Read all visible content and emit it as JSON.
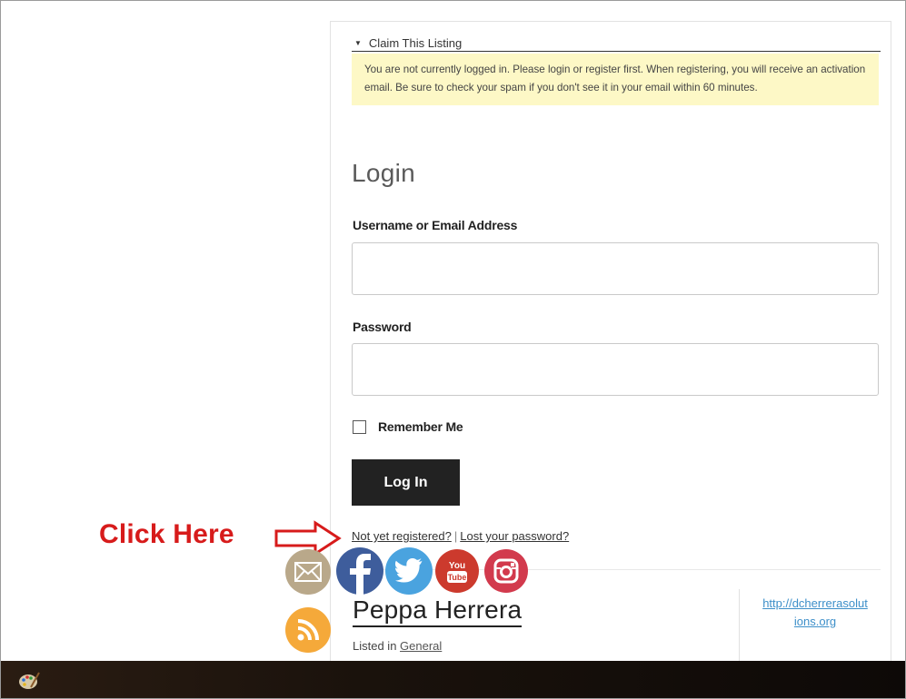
{
  "claim": {
    "header": "Claim This Listing",
    "notice": "You are not currently logged in. Please login or register first. When registering, you will receive an activation email. Be sure to check your spam if you don't see it in your email within 60 minutes."
  },
  "login": {
    "title": "Login",
    "username_label": "Username or Email Address",
    "username_value": "",
    "password_label": "Password",
    "password_value": "",
    "remember_label": "Remember Me",
    "remember_checked": false,
    "button": "Log In",
    "register_link": "Not yet registered?",
    "separator": "|",
    "lost_password_link": "Lost your password?"
  },
  "annotation": {
    "text": "Click Here",
    "color": "#d71b1b"
  },
  "social": [
    "email-icon",
    "facebook-icon",
    "twitter-icon",
    "youtube-icon",
    "instagram-icon",
    "rss-icon"
  ],
  "listing": {
    "name": "Peppa Herrera",
    "listed_in_prefix": "Listed in",
    "category": "General",
    "website_line1": "http://dcherrerasolut",
    "website_line2": "ions.org"
  }
}
